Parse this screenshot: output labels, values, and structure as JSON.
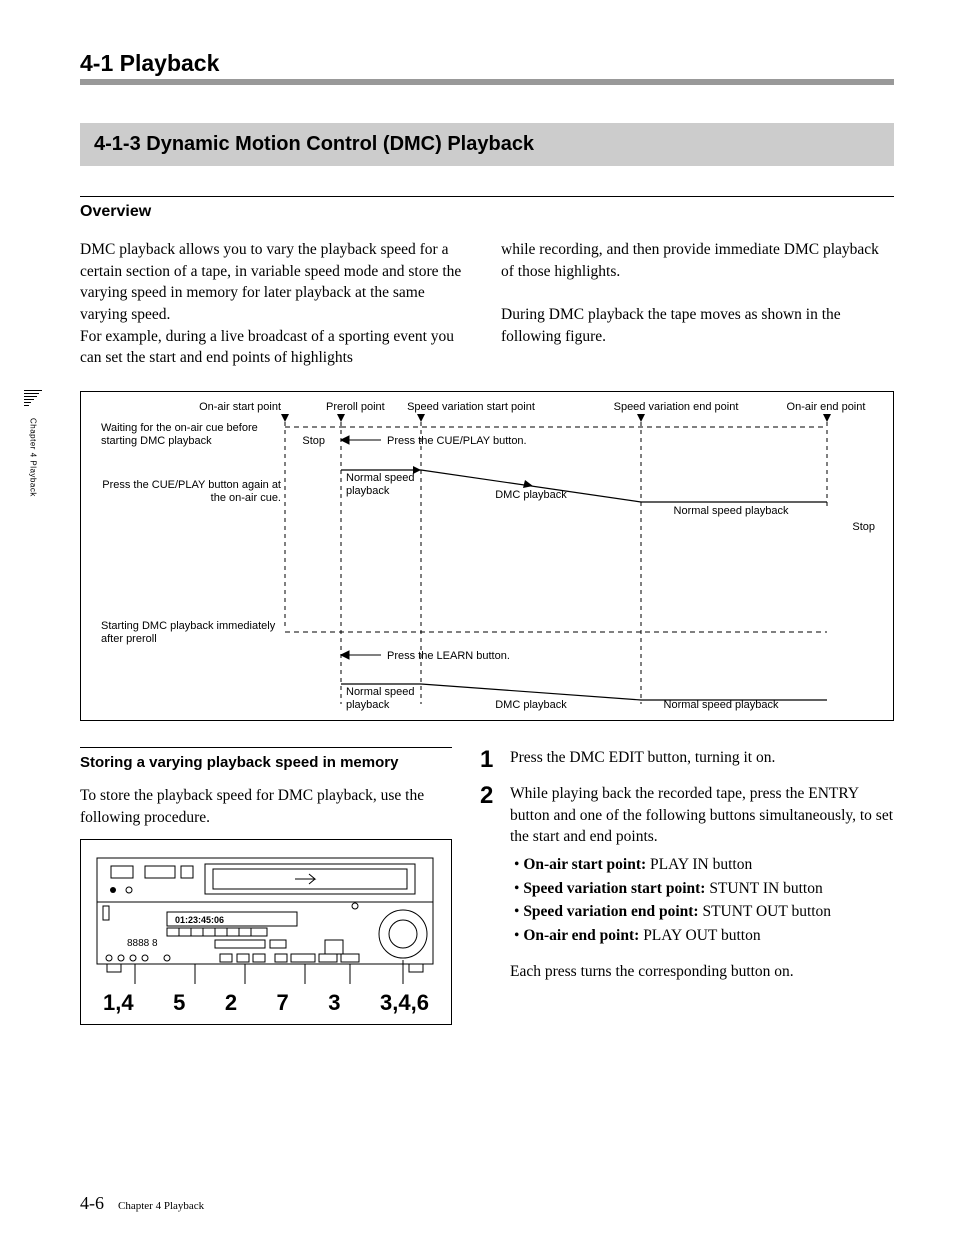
{
  "side": {
    "text": "Chapter 4  Playback"
  },
  "header": {
    "title": "4-1 Playback"
  },
  "section": {
    "title": "4-1-3  Dynamic Motion Control (DMC) Playback"
  },
  "overview": {
    "heading": "Overview",
    "col1": "DMC playback allows you to vary the playback speed for a certain section of a tape, in variable speed mode and store the varying speed in memory for later playback at the same varying speed.\nFor example, during a live broadcast of a sporting event you can set the start and end points of highlights",
    "col2": "while recording, and then provide immediate DMC playback of those highlights.\n\nDuring DMC playback the tape moves as shown in the following figure."
  },
  "figure": {
    "labels": {
      "onair_start": "On-air start point",
      "preroll": "Preroll point",
      "var_start": "Speed variation start point",
      "var_end": "Speed variation end point",
      "onair_end": "On-air end point",
      "wait": "Waiting for the on-air cue before starting DMC playback",
      "stop1": "Stop",
      "press_cue": "Press the CUE/PLAY button.",
      "press_cue_again": "Press the CUE/PLAY button again at the on-air cue.",
      "normal1": "Normal speed playback",
      "dmc1": "DMC playback",
      "normal_right1": "Normal speed playback",
      "stop2": "Stop",
      "starting": "Starting DMC playback immediately after preroll",
      "press_learn": "Press the LEARN button.",
      "normal2": "Normal speed playback",
      "dmc2": "DMC playback",
      "normal_right2": "Normal speed playback"
    }
  },
  "storing": {
    "heading": "Storing a varying playback speed in memory",
    "intro": "To store the playback speed for DMC playback, use the following procedure.",
    "callouts": [
      "1,4",
      "5",
      "2",
      "7",
      "3",
      "3,4,6"
    ]
  },
  "steps": {
    "s1": "Press the DMC EDIT button, turning it on.",
    "s2": {
      "text": "While playing back the recorded tape, press the ENTRY button and one of the following buttons simultaneously, to set the start and end points.",
      "b1l": "On-air start point:",
      "b1v": "PLAY IN button",
      "b2l": "Speed variation start point:",
      "b2v": "STUNT IN button",
      "b3l": "Speed variation end point:",
      "b3v": "STUNT OUT button",
      "b4l": "On-air end point:",
      "b4v": "PLAY OUT button",
      "after": "Each press turns the corresponding button on."
    }
  },
  "footer": {
    "page": "4-6",
    "chapter": "Chapter 4  Playback"
  },
  "device": {
    "timecode": "01:23:45:06"
  }
}
